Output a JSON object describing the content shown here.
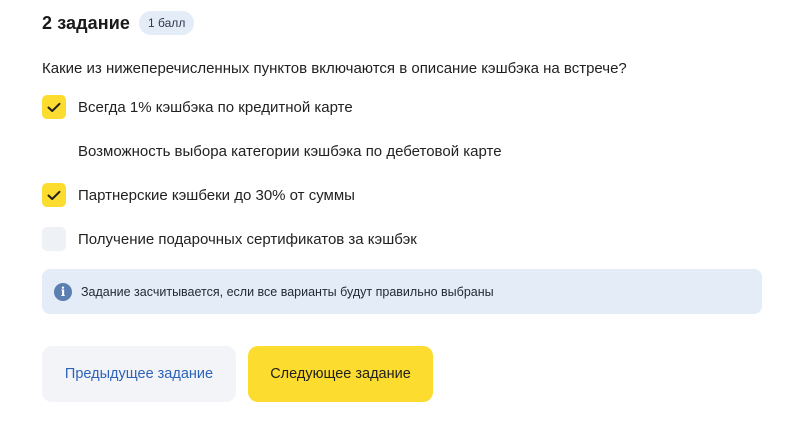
{
  "task": {
    "title": "2 задание",
    "points_badge": "1 балл"
  },
  "question": "Какие из нижеперечисленных пунктов включаются в описание кэшбэка на встрече?",
  "options": [
    {
      "label": "Всегда 1% кэшбэка по кредитной карте",
      "checked": true
    },
    {
      "label": "Возможность выбора категории кэшбэка по дебетовой карте",
      "checked": false
    },
    {
      "label": "Партнерские кэшбеки до 30% от суммы",
      "checked": true
    },
    {
      "label": "Получение подарочных сертификатов за кэшбэк",
      "checked": false
    }
  ],
  "info": {
    "icon": "info-icon",
    "text": "Задание засчитывается, если все варианты будут правильно выбраны"
  },
  "buttons": {
    "prev_label": "Предыдущее задание",
    "next_label": "Следующее задание"
  },
  "colors": {
    "accent_yellow": "#fcdc2e",
    "info_bg": "#e4ecf7",
    "link_blue": "#2d63b8"
  }
}
